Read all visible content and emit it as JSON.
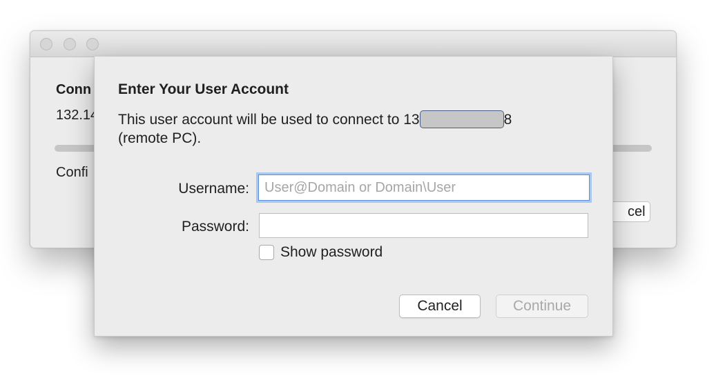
{
  "background_window": {
    "title_partial": "Conn",
    "address_partial": "132.14",
    "status_partial": "Confi",
    "cancel_partial": "cel"
  },
  "dialog": {
    "heading": "Enter Your User Account",
    "message_prefix": "This user account will be used to connect to 13",
    "message_suffix": "8",
    "message_line2": "(remote PC).",
    "username_label": "Username:",
    "username_placeholder": "User@Domain or Domain\\User",
    "username_value": "",
    "password_label": "Password:",
    "password_value": "",
    "show_password_label": "Show password",
    "show_password_checked": false,
    "cancel_label": "Cancel",
    "continue_label": "Continue",
    "continue_enabled": false
  },
  "colors": {
    "window_bg": "#ececec",
    "focus_ring": "#a9c8f1",
    "disabled_text": "#a8a8a8"
  }
}
